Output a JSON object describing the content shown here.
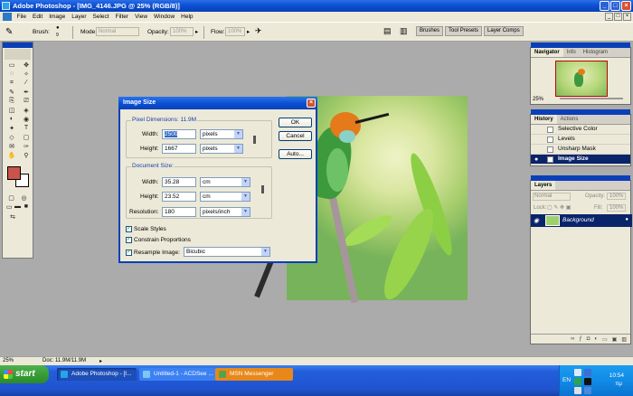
{
  "window": {
    "title": "Adobe Photoshop - [IMG_4146.JPG @ 25% (RGB/8)]",
    "controls": [
      "_",
      "□",
      "×"
    ]
  },
  "menubar": {
    "items": [
      "File",
      "Edit",
      "Image",
      "Layer",
      "Select",
      "Filter",
      "View",
      "Window",
      "Help"
    ]
  },
  "options_bar": {
    "brush_label": "Brush:",
    "brush_size": "9",
    "mode_label": "Mode:",
    "mode_value": "Normal",
    "opacity_label": "Opacity:",
    "opacity_value": "100%",
    "flow_label": "Flow:",
    "flow_value": "100%",
    "wells": [
      "Brushes",
      "Tool Presets",
      "Layer Comps"
    ]
  },
  "toolbox": {
    "tools": [
      "▭",
      "✥",
      "◌",
      "✧",
      "⌗",
      "⁄",
      "✎",
      "✒",
      "⎘",
      "⎚",
      "◫",
      "◈",
      "◐",
      "◉",
      "✦",
      "T",
      "◇",
      "▢",
      "✉",
      "✑",
      "✋",
      "⚲"
    ]
  },
  "dialog": {
    "title": "Image Size",
    "close": "×",
    "pixel_dimensions_label": "Pixel Dimensions: 11.9M",
    "pixel_width_label": "Width:",
    "pixel_width_value": "2500",
    "pixel_width_unit": "pixels",
    "pixel_height_label": "Height:",
    "pixel_height_value": "1667",
    "pixel_height_unit": "pixels",
    "document_size_label": "Document Size:",
    "doc_width_label": "Width:",
    "doc_width_value": "35.28",
    "doc_width_unit": "cm",
    "doc_height_label": "Height:",
    "doc_height_value": "23.52",
    "doc_height_unit": "cm",
    "resolution_label": "Resolution:",
    "resolution_value": "180",
    "resolution_unit": "pixels/inch",
    "scale_styles": "Scale Styles",
    "constrain_proportions": "Constrain Proportions",
    "resample_label": "Resample Image:",
    "resample_value": "Bicubic",
    "ok": "OK",
    "cancel": "Cancel",
    "auto": "Auto..."
  },
  "navigator": {
    "tabs": [
      "Navigator",
      "Info",
      "Histogram"
    ],
    "zoom": "25%"
  },
  "history": {
    "tabs": [
      "History",
      "Actions"
    ],
    "items": [
      "Selective Color",
      "Levels",
      "Unsharp Mask",
      "Image Size"
    ]
  },
  "layers": {
    "tabs": [
      "Layers"
    ],
    "blend_mode": "Normal",
    "opacity_label": "Opacity:",
    "opacity_value": "100%",
    "lock_label": "Lock:",
    "fill_label": "Fill:",
    "fill_value": "100%",
    "layer_name": "Background"
  },
  "statusbar": {
    "zoom": "25%",
    "doc": "Doc: 11.9M/11.9M"
  },
  "taskbar": {
    "start": "start",
    "tasks": [
      "Adobe Photoshop - [I...",
      "Untitled-1 - ACDSee ...",
      "MSN Messenger"
    ],
    "lang": "EN",
    "time": "10:54",
    "ampm": "πμ"
  },
  "colors": {
    "foreground": "#c9544b",
    "background": "#ffffff",
    "titlebar": "#0a4fd2",
    "selection": "#0a246a"
  }
}
